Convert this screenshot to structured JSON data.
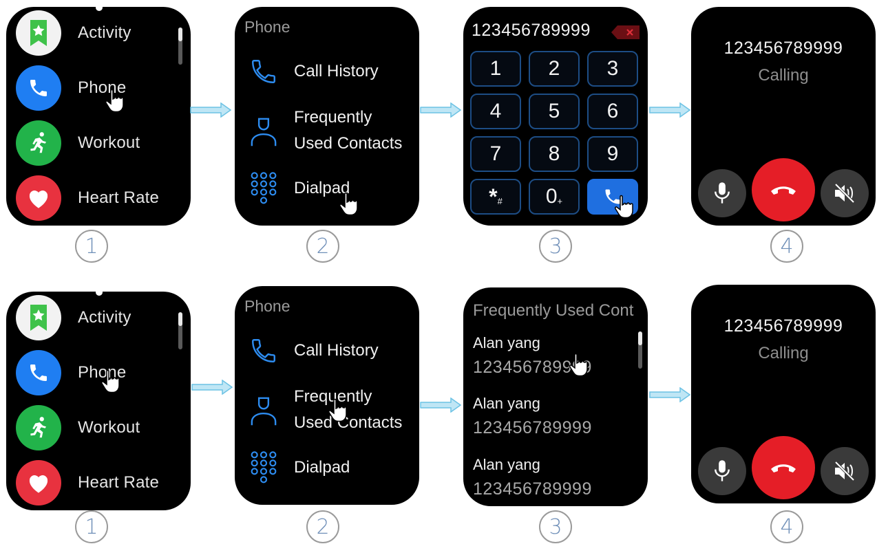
{
  "colors": {
    "accent_blue": "#1f6fe0",
    "dial_border": "#1d4d85",
    "end_call_red": "#e51e27",
    "activity_green": "#3fc24a",
    "phone_blue": "#1f7ef2",
    "workout_green": "#22b34a",
    "heart_red": "#e8323f"
  },
  "app_list": {
    "items": [
      {
        "label": "Activity",
        "icon": "activity-icon"
      },
      {
        "label": "Phone",
        "icon": "phone-icon"
      },
      {
        "label": "Workout",
        "icon": "workout-icon"
      },
      {
        "label": "Heart Rate",
        "icon": "heart-icon"
      }
    ]
  },
  "phone_menu": {
    "title": "Phone",
    "call_history": "Call History",
    "frequent_line1": "Frequently",
    "frequent_line2": "Used Contacts",
    "dialpad": "Dialpad"
  },
  "dialpad": {
    "number": "123456789999",
    "keys": [
      "1",
      "2",
      "3",
      "4",
      "5",
      "6",
      "7",
      "8",
      "9"
    ],
    "star_key": "*",
    "star_sub": "#",
    "zero_key": "0",
    "zero_sub": "+"
  },
  "contacts": {
    "title": "Frequently Used Cont",
    "items": [
      {
        "name": "Alan yang",
        "number": "123456789999"
      },
      {
        "name": "Alan yang",
        "number": "123456789999"
      },
      {
        "name": "Alan yang",
        "number": "123456789999"
      }
    ]
  },
  "calling": {
    "number": "123456789999",
    "status": "Calling"
  },
  "steps": {
    "row1": [
      "1",
      "2",
      "3",
      "4"
    ],
    "row2": [
      "1",
      "2",
      "3",
      "4"
    ]
  }
}
